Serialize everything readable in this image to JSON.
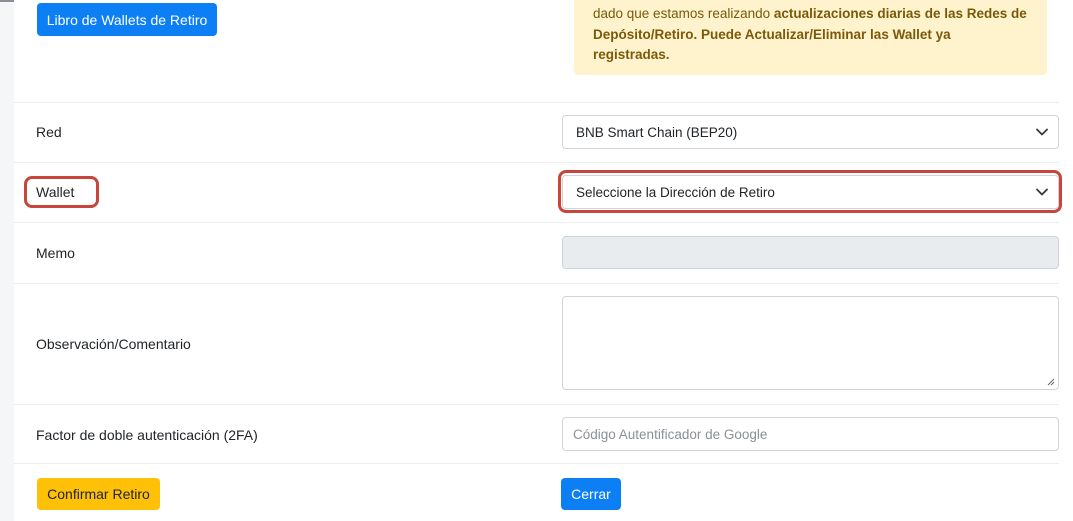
{
  "header": {
    "wallet_book_button": "Libro de Wallets de Retiro"
  },
  "notice": {
    "text_plain": "dado que estamos realizando ",
    "text_bold": "actualizaciones diarias de las Redes de Depósito/Retiro. Puede Actualizar/Eliminar las Wallet ya registradas."
  },
  "form": {
    "network": {
      "label": "Red",
      "selected": "BNB Smart Chain (BEP20)"
    },
    "wallet": {
      "label": "Wallet",
      "selected": "Seleccione la Dirección de Retiro"
    },
    "memo": {
      "label": "Memo",
      "value": ""
    },
    "comment": {
      "label": "Observación/Comentario",
      "value": ""
    },
    "twofa": {
      "label": "Factor de doble autenticación (2FA)",
      "placeholder": "Código Autentificador de Google"
    }
  },
  "actions": {
    "confirm_label": "Confirmar Retiro",
    "close_label": "Cerrar"
  },
  "colors": {
    "primary": "#0d7ff5",
    "warning": "#ffc107",
    "alert_bg": "#fff3cd",
    "highlight": "#c7453a"
  },
  "icons": {
    "select_arrow": "chevron-down-icon",
    "textarea_resize": "resize-grip-icon"
  }
}
